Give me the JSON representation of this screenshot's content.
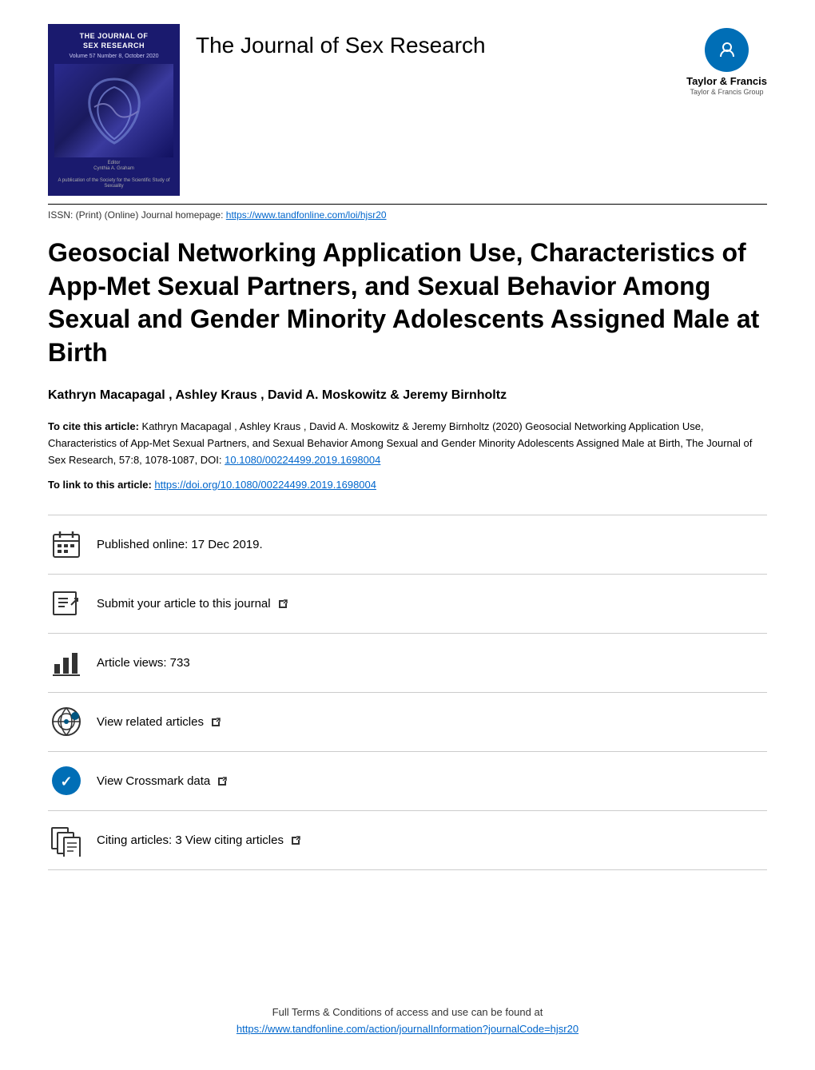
{
  "journal": {
    "name": "The Journal of Sex Research",
    "cover_title": "The Journal of\nSex Research",
    "issn_text": "ISSN: (Print) (Online) Journal homepage:",
    "issn_url": "https://www.tandfonline.com/loi/hjsr20",
    "issn_url_display": "https://www.tandfonline.com/loi/hjsr20"
  },
  "publisher": {
    "name": "Taylor & Francis",
    "subname": "Taylor & Francis Group"
  },
  "article": {
    "title": "Geosocial Networking Application Use, Characteristics of App-Met Sexual Partners, and Sexual Behavior Among Sexual and Gender Minority Adolescents Assigned Male at Birth",
    "authors": "Kathryn Macapagal , Ashley Kraus , David A. Moskowitz & Jeremy Birnholtz",
    "citation_label": "To cite this article:",
    "citation_text": "Kathryn Macapagal , Ashley Kraus , David A. Moskowitz & Jeremy Birnholtz (2020) Geosocial Networking Application Use, Characteristics of App-Met Sexual Partners, and Sexual Behavior Among Sexual and Gender Minority Adolescents Assigned Male at Birth, The Journal of Sex Research, 57:8, 1078-1087, DOI:",
    "citation_doi": "10.1080/00224499.2019.1698004",
    "citation_doi_url": "https://doi.org/10.1080/00224499.2019.1698004",
    "link_label": "To link to this article:",
    "link_url": "https://doi.org/10.1080/00224499.2019.1698004",
    "link_url_display": "https://doi.org/10.1080/00224499.2019.1698004"
  },
  "actions": [
    {
      "id": "published",
      "icon": "calendar-icon",
      "text": "Published online: 17 Dec 2019.",
      "link": false
    },
    {
      "id": "submit",
      "icon": "submit-icon",
      "text": "Submit your article to this journal",
      "link": true,
      "external": true
    },
    {
      "id": "views",
      "icon": "chart-icon",
      "text": "Article views: 733",
      "link": false
    },
    {
      "id": "related",
      "icon": "related-icon",
      "text": "View related articles",
      "link": true,
      "external": true
    },
    {
      "id": "crossmark",
      "icon": "crossmark-icon",
      "text": "View Crossmark data",
      "link": true,
      "external": true
    },
    {
      "id": "citing",
      "icon": "citing-icon",
      "text": "Citing articles: 3 View citing articles",
      "link": true,
      "external": true
    }
  ],
  "footer": {
    "line1": "Full Terms & Conditions of access and use can be found at",
    "line2_url": "https://www.tandfonline.com/action/journalInformation?journalCode=hjsr20",
    "line2_display": "https://www.tandfonline.com/action/journalInformation?journalCode=hjsr20"
  }
}
